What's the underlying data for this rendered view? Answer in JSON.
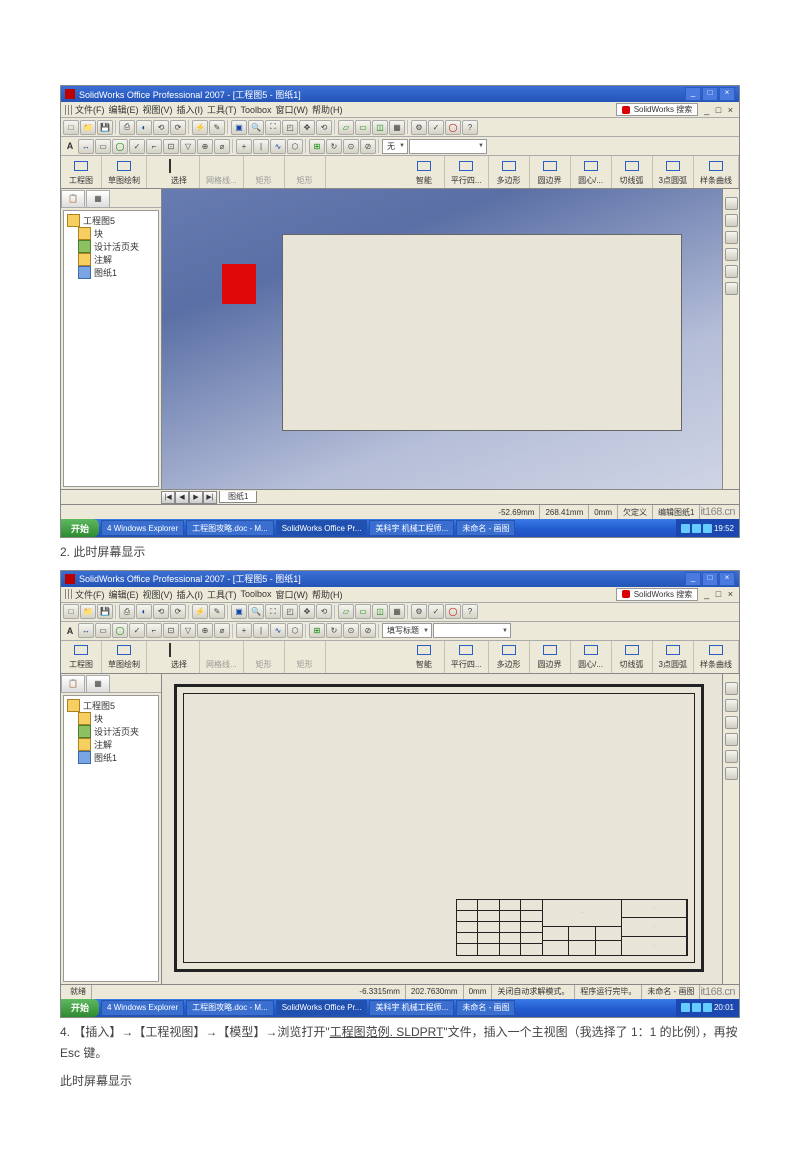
{
  "app": {
    "title": "SolidWorks Office Professional 2007 - [工程图5 - 图纸1]",
    "searchPlaceholder": "SolidWorks 搜索"
  },
  "menus": {
    "file": "文件(F)",
    "edit": "编辑(E)",
    "view": "视图(V)",
    "insert": "插入(I)",
    "tools": "工具(T)",
    "toolbox": "Toolbox",
    "window": "窗口(W)",
    "help": "帮助(H)"
  },
  "ribbon": {
    "g1": "工程图",
    "g2": "草图绘制",
    "sel": "选择",
    "rect": "网格线...",
    "rect2": "矩形",
    "circ": "矩形",
    "smart": "智能",
    "para": "平行四...",
    "poly": "多边形",
    "arc": "圆边界",
    "conc": "圆心/...",
    "tang": "切线弧",
    "pts": "3点圆弧",
    "spline": "样条曲线"
  },
  "combo1": "无",
  "combo2": "填写标题",
  "tree": {
    "root": "工程图5",
    "n1": "块",
    "n2": "设计活页夹",
    "n3": "注解",
    "n4": "图纸1"
  },
  "sheetTab": "图纸1",
  "status1": {
    "x": "-52.69mm",
    "y": "268.41mm",
    "z": "0mm",
    "mode": "欠定义",
    "extra": "编辑图纸1"
  },
  "status2": {
    "x": "-6.3315mm",
    "y": "202.7630mm",
    "z": "0mm",
    "mode": "关闭自动求解模式。",
    "extra": "程序运行完毕。",
    "cmd": "未命名 - 画图"
  },
  "statusLeft2": "就绪",
  "logo168": "it168.cn",
  "taskbar": {
    "start": "开始",
    "b1": "4 Windows Explorer",
    "b2": "工程图攻略.doc - M...",
    "b3": "SolidWorks Office Pr...",
    "b4": "美科宇 机械工程师...",
    "b5": "未命名 - 画图",
    "time1": "19:52",
    "time2": "20:01"
  },
  "caption1": "2.  此时屏幕显示",
  "caption2a": "4. 【插入】→【工程视图】→【模型】→浏览打开\"",
  "caption2link": "工程图范例. SLDPRT",
  "caption2b": "\"文件，插入一个主视图（我选择了 1：1 的比例），再按 Esc 键。",
  "caption3": "此时屏幕显示"
}
